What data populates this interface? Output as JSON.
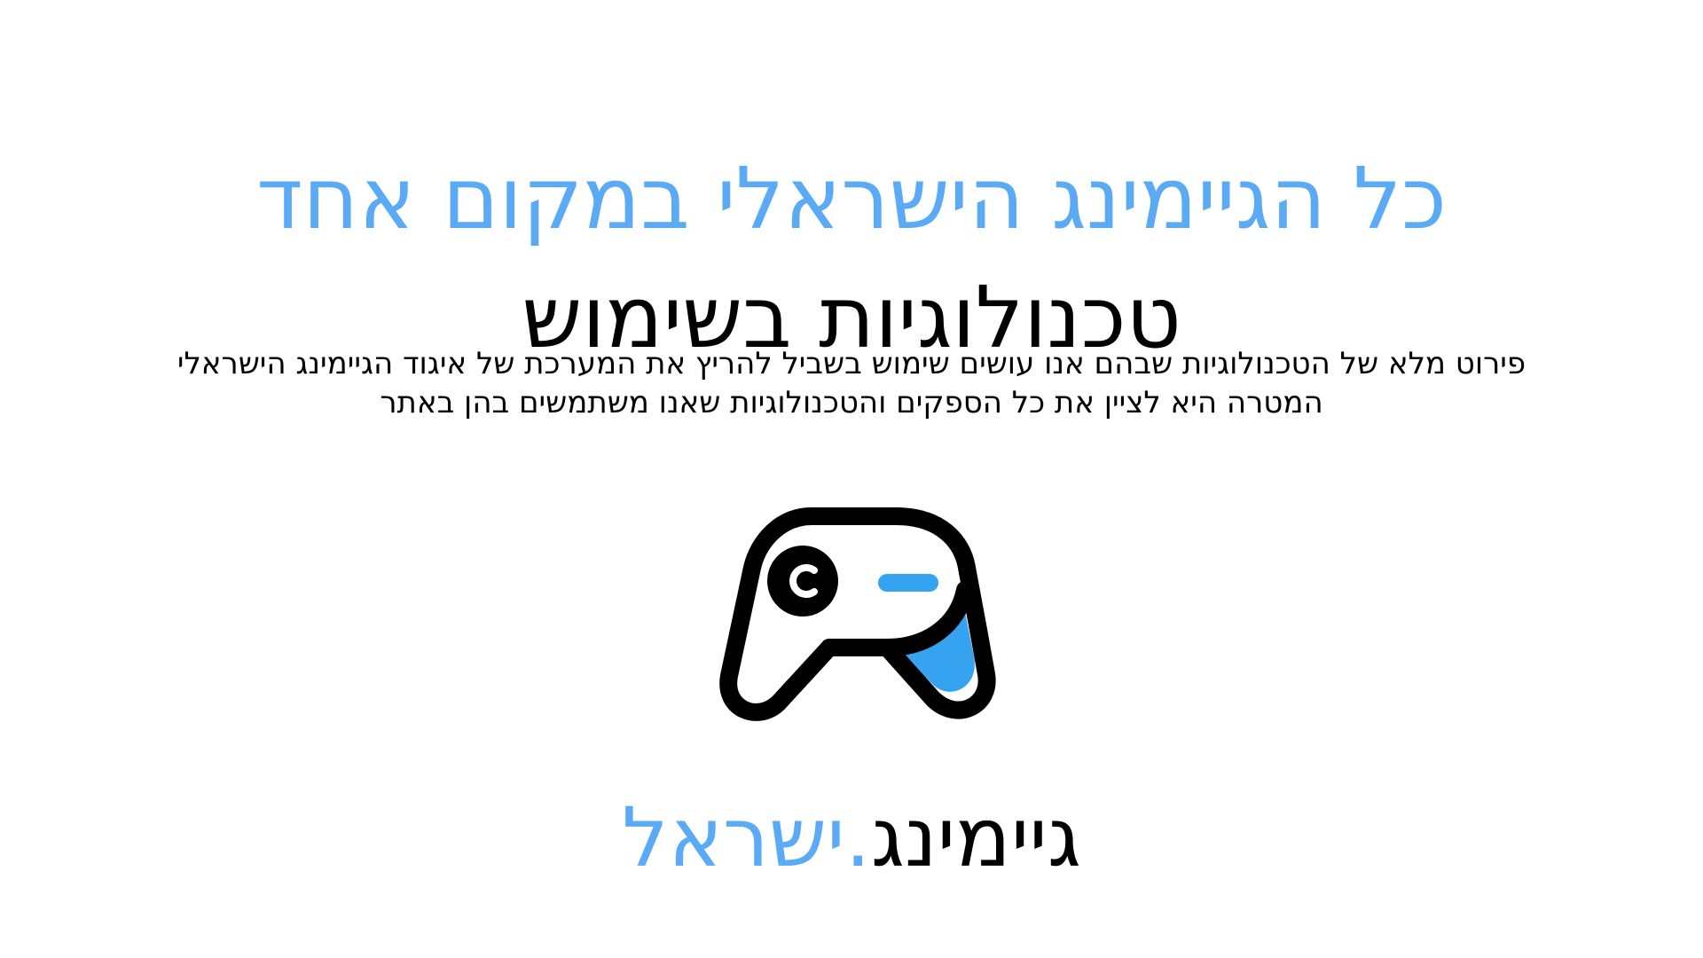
{
  "headline": {
    "line1": "כל הגיימינג הישראלי במקום אחד",
    "line2": "טכנולוגיות בשימוש"
  },
  "description": {
    "line1": "פירוט מלא של הטכנולוגיות שבהם אנו עושים שימוש בשביל להריץ את המערכת של איגוד הגיימינג הישראלי",
    "line2": "המטרה היא לציין את כל הספקים והטכנולוגיות שאנו משתמשים בהן באתר"
  },
  "logo": {
    "icon": "gamepad-icon",
    "accent_color": "#36a3f0",
    "outline_color": "#000000"
  },
  "brand": {
    "name_part1": "גיימינג",
    "name_part2": ".ישראל"
  },
  "colors": {
    "accent": "#5aaaf5",
    "text": "#000000",
    "background": "#ffffff"
  }
}
